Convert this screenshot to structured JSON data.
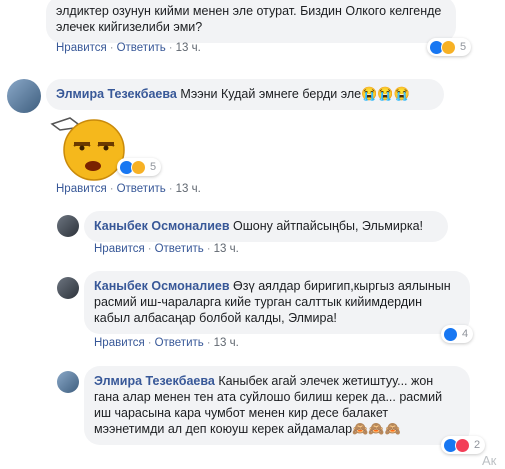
{
  "comments": [
    {
      "text": "элдиктер озунун кийми менен эле отурат. Биздин Олкого келгенде элечек кийгизелиби эми?",
      "actions": {
        "like": "Нравится",
        "reply": "Ответить",
        "time": "13 ч."
      },
      "reactions": {
        "types": [
          "like",
          "haha"
        ],
        "count": "5"
      }
    },
    {
      "author": "Элмира Тезекбаева",
      "text": "Мээни Кудай эмнеге берди эле",
      "emojis": "😭😭😭",
      "sticker_icon": "unamused-face-sticker",
      "actions": {
        "like": "Нравится",
        "reply": "Ответить",
        "time": "13 ч."
      },
      "reactions": {
        "types": [
          "like",
          "haha"
        ],
        "count": "5"
      }
    },
    {
      "author": "Каныбек Осмоналиев",
      "text": "Ошону айтпайсыңбы, Эльмирка!",
      "actions": {
        "like": "Нравится",
        "reply": "Ответить",
        "time": "13 ч."
      }
    },
    {
      "author": "Каныбек Осмоналиев",
      "text": "Өзү аялдар биригип,кыргыз аялынын расмий иш-чараларга кийе турган салттык кийимдердин кабыл албасаңар болбой калды, Элмира!",
      "actions": {
        "like": "Нравится",
        "reply": "Ответить",
        "time": "13 ч."
      },
      "reactions": {
        "types": [
          "like"
        ],
        "count": "4"
      }
    },
    {
      "author": "Элмира Тезекбаева",
      "text": "Каныбек агай элечек жетиштуу... жон гана алар менен тен ата суйлошо билиш керек да... расмий иш чарасына кара чумбот менен кир десе балакет мээнетимди ал деп коюуш керек айдамалар",
      "emojis": "🙈🙈🙈",
      "actions": {
        "like": "Нравится",
        "reply": "Ответить",
        "time": "13 ч."
      },
      "reactions": {
        "types": [
          "like",
          "love"
        ],
        "count": "2"
      }
    }
  ],
  "corner_text": "Ак"
}
